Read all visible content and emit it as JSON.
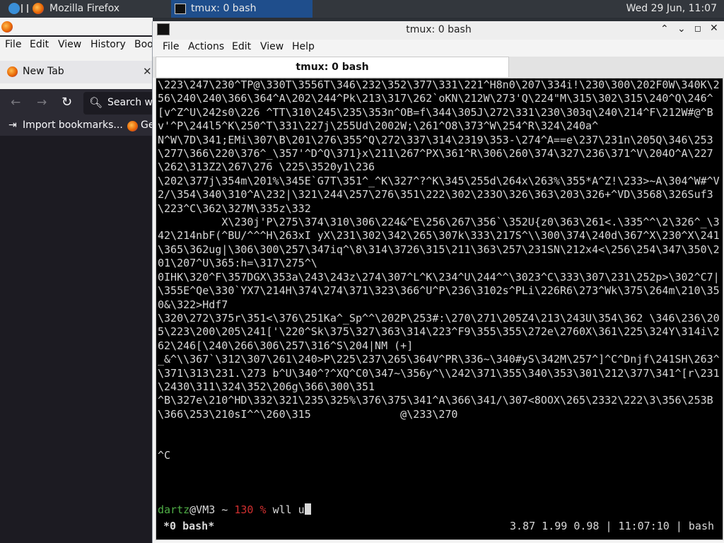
{
  "taskbar": {
    "tasks": [
      {
        "label": "Mozilla Firefox",
        "active": false
      },
      {
        "label": "tmux: 0 bash",
        "active": true
      }
    ],
    "clock": "Wed 29 Jun, 11:07"
  },
  "firefox": {
    "menu": [
      "File",
      "Edit",
      "View",
      "History",
      "Boo"
    ],
    "tab_label": "New Tab",
    "search_placeholder": "Search w",
    "bookmarks": [
      "Import bookmarks...",
      "Ge"
    ]
  },
  "terminal": {
    "title": "tmux: 0 bash",
    "menu": [
      "File",
      "Actions",
      "Edit",
      "View",
      "Help"
    ],
    "tab_label": "tmux: 0 bash",
    "output": "\\223\\247\\230^TP@\\330T\\3556T\\346\\232\\352\\377\\331\\221^H8n0\\207\\334i!\\230\\300\\202F0W\\340K\\256\\240\\240\\366\\364^A\\202\\244^Pk\\213\\317\\262`oKN\\212W\\273'Q\\224\"M\\315\\302\\315\\240^Q\\246^[v^Z^U\\242s0\\226 ^TT\\310\\245\\235\\353n^OB=f\\344\\305J\\272\\331\\230\\303q\\240\\214^F\\212W#@^Bv'^P\\244l5^K\\250^T\\331\\227j\\255Ud\\2002W;\\261^O8\\373^W\\254^R\\324\\240a^\nN^W\\7D\\341;EMi\\307\\B\\201\\276\\355^Q\\272\\337\\314\\2319\\353-\\274^A==e\\237\\231n\\205Q\\346\\253\\277\\366\\220\\376^_\\357'^D^Q\\371}x\\211\\267^PX\\361^R\\306\\260\\374\\327\\236\\371^V\\204O^A\\227\\262\\313Z2\\267\\276 \\225\\3520y1\\236\n\\202\\377j\\354m\\201%\\345E`G7T\\351^_^K\\327^?^K\\345\\255d\\264x\\263%\\355*A^Z!\\233>~A\\304^W#^V2/\\354\\340\\310^A\\232|\\321\\244\\257\\276\\351\\222\\302\\233O\\326\\363\\203\\326+^VD\\3568\\326Suf3\\223^C\\362\\327M\\335z\\332\n          X\\230j'P\\275\\374\\310\\306\\224&^E\\256\\267\\356`\\352U{z0\\363\\261<.\\335^^\\2\\326^_\\342\\214nbF(^BU/^^^H\\263xI yX\\231\\302\\342\\265\\307k\\333\\217S^\\\\300\\374\\240d\\367^X\\230^X\\241\\365\\362ug|\\306\\300\\257\\347iq^\\8\\314\\3726\\315\\211\\363\\257\\231SN\\212x4<\\256\\254\\347\\350\\201\\207^U\\365:h=\\317\\275^\\\n0IHK\\320^F\\357DGX\\353a\\243\\243z\\274\\307^L^K\\234^U\\244^^\\3023^C\\333\\307\\231\\252p>\\302^C7|\\355E^Qe\\330`YX7\\214H\\374\\274\\371\\323\\366^U^P\\236\\3102s^PLi\\226R6\\273^Wk\\375\\264m\\210\\350&\\322>Hdf7\n\\320\\272\\375r\\351<\\376\\251Ka^_Sp^^\\202P\\253#:\\270\\271\\205Z4\\213\\243U\\354\\362 \\346\\236\\205\\223\\200\\205\\241['\\220^Sk\\375\\327\\363\\314\\223^F9\\355\\355\\272e\\2760X\\361\\225\\324Y\\314i\\262\\246[\\240\\266\\306\\257\\316^S\\204|NM (+]\n_&^\\\\367`\\312\\307\\261\\240>P\\225\\237\\265\\364V^PR\\336~\\340#yS\\342M\\257^]^C^Dnjf\\241SH\\263^\\371\\313\\231.\\273 b^U\\340^?^XQ^C0\\347~\\356y^\\\\242\\371\\355\\340\\353\\301\\212\\377\\341^[r\\231\\2430\\311\\324\\352\\206g\\366\\300\\351\n^B\\327e\\210^HD\\332\\321\\235\\325%\\376\\375\\341^A\\366\\341/\\307<8OOX\\265\\2332\\222\\3\\356\\253B\\366\\253\\210sI^^\\260\\315              @\\233\\270\n\n\n^C",
    "prompt": {
      "user_host": "dartz",
      "at_host": "@VM3",
      "tilde": " ~ ",
      "exit_code": "130",
      "percent": " % ",
      "command": "wll u"
    },
    "status": {
      "window": "*0 bash*",
      "right": "3.87 1.99 0.98 | 11:07:10 | bash"
    }
  },
  "colors": {
    "prompt_user": "#4fae46",
    "prompt_error": "#d02f2f",
    "task_active": "#1f4e8c"
  }
}
